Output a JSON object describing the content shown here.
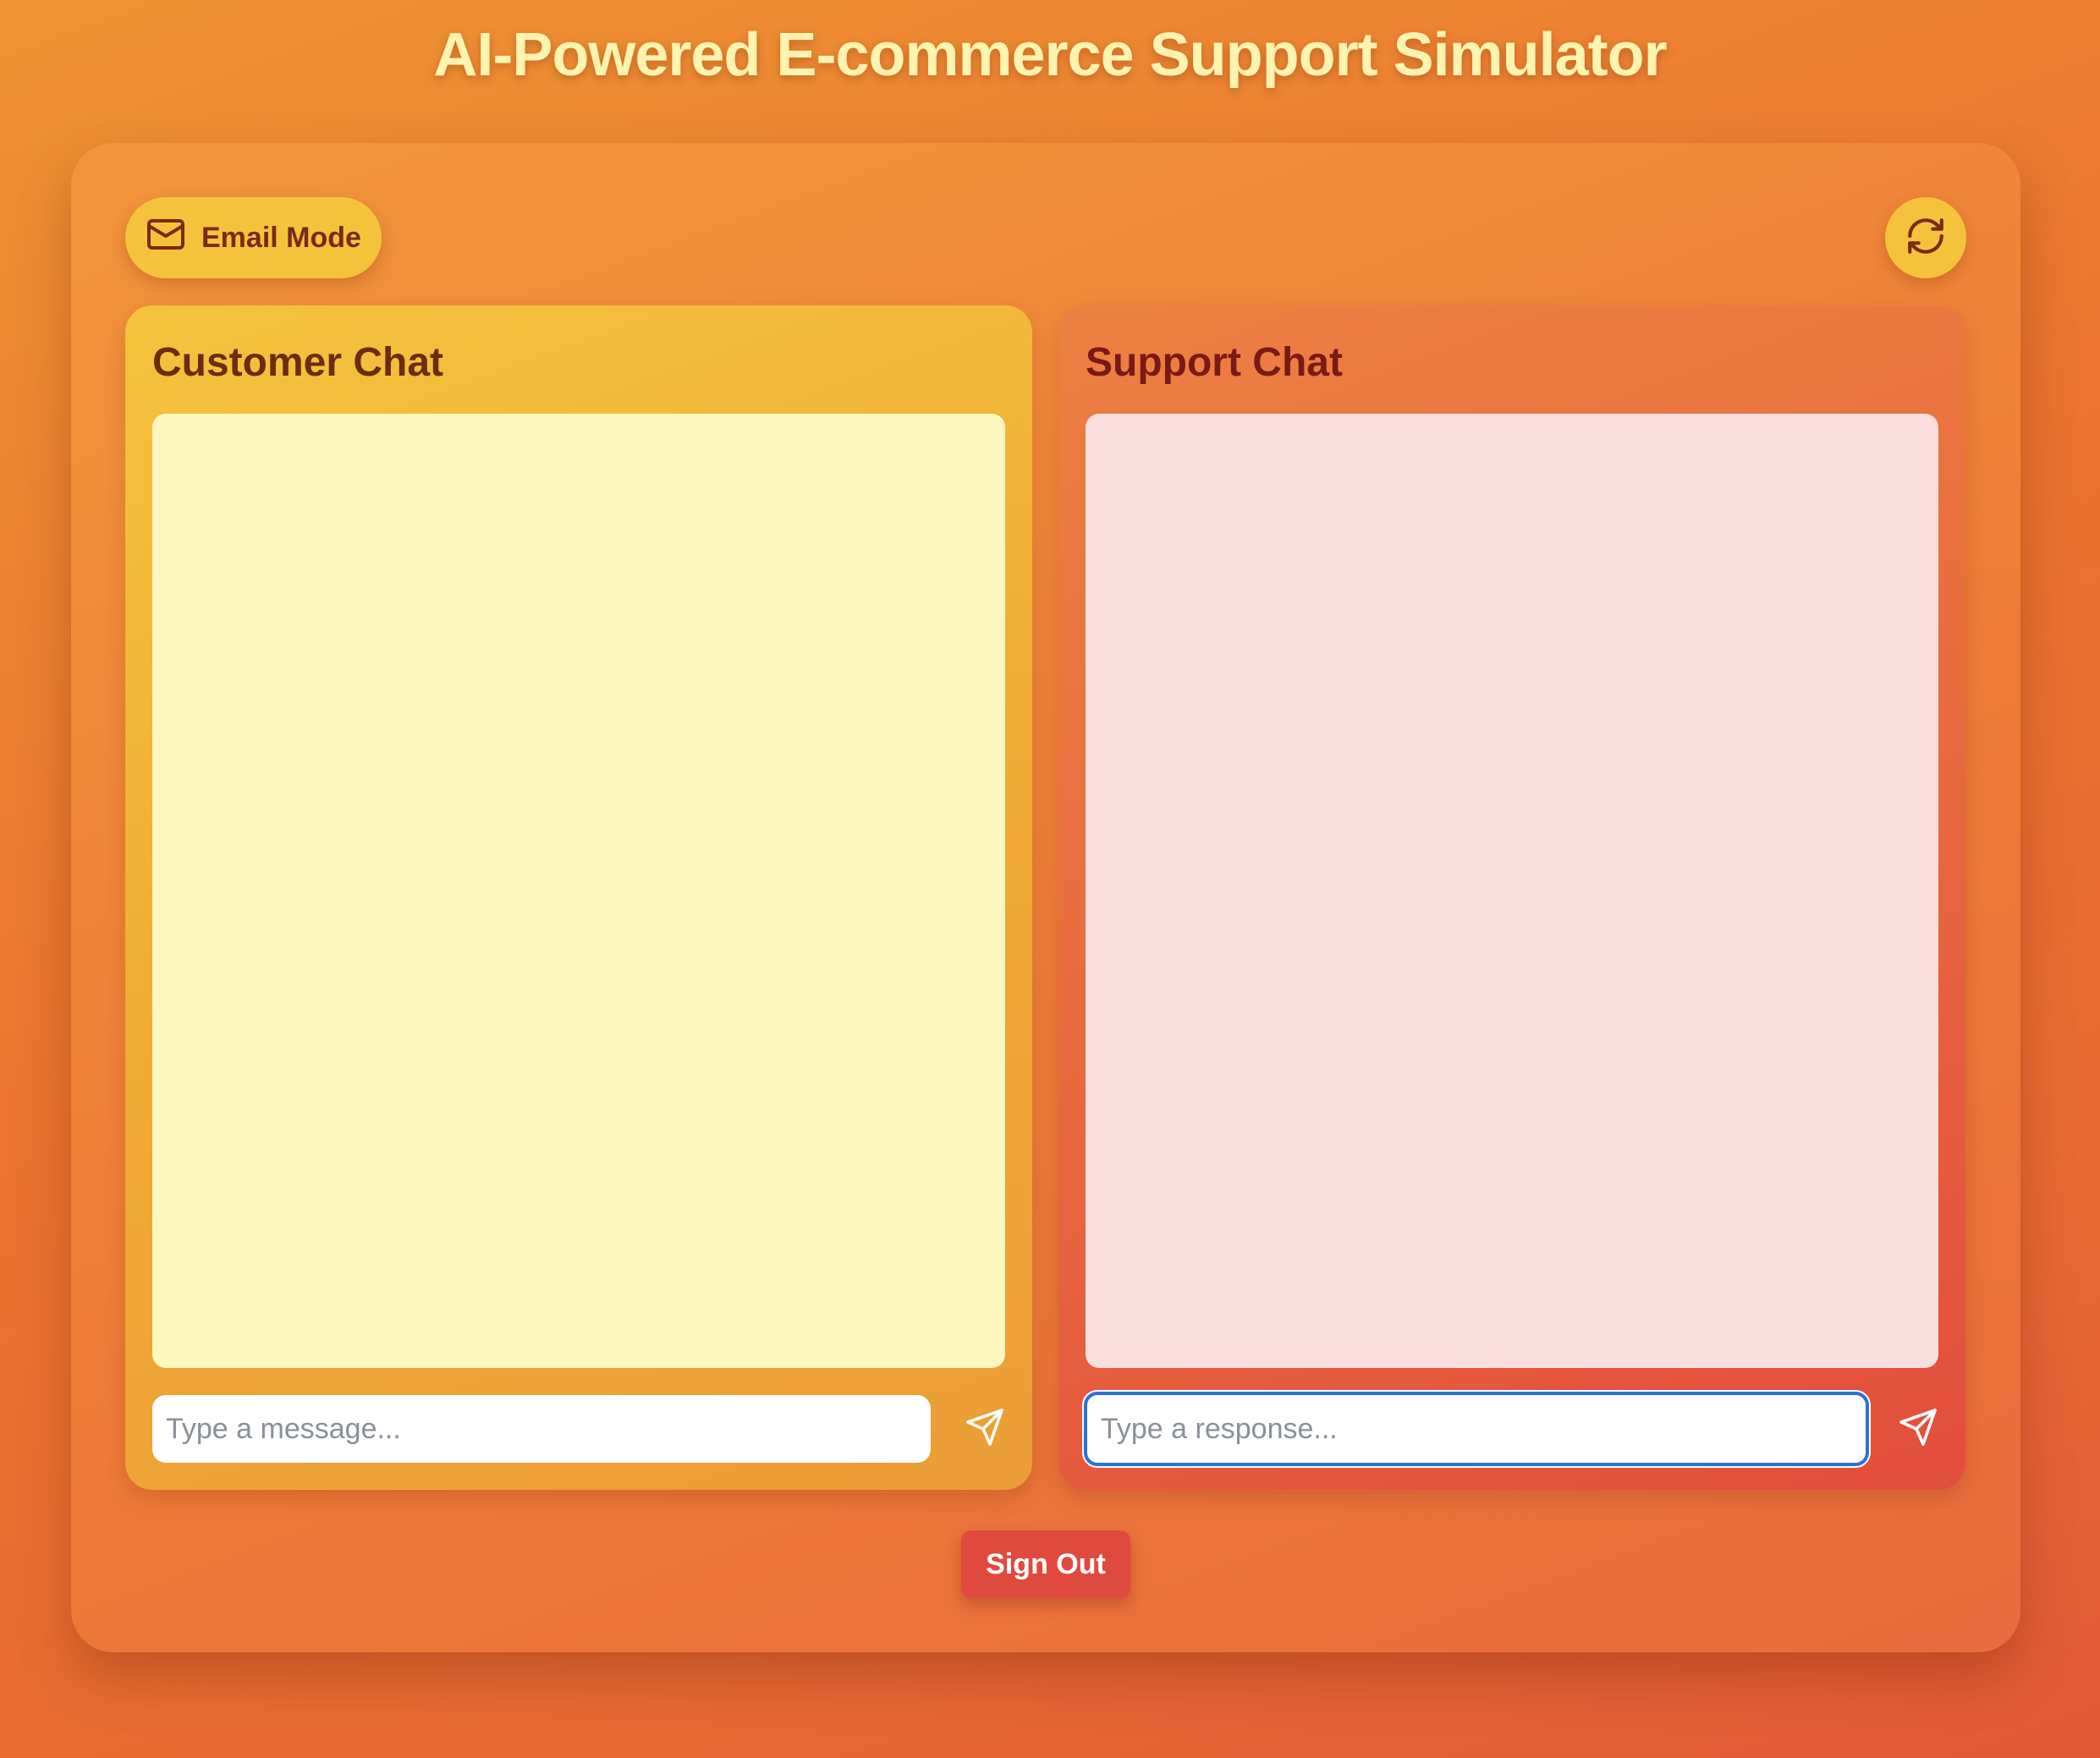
{
  "app": {
    "title": "AI-Powered E-commerce Support Simulator"
  },
  "toolbar": {
    "email_mode_label": "Email Mode",
    "email_icon": "mail-icon",
    "refresh_icon": "refresh-icon"
  },
  "customer_panel": {
    "title": "Customer Chat",
    "input_value": "",
    "input_placeholder": "Type a message...",
    "send_icon": "send-icon"
  },
  "support_panel": {
    "title": "Support Chat",
    "input_value": "",
    "input_placeholder": "Type a response...",
    "send_icon": "send-icon"
  },
  "footer": {
    "sign_out_label": "Sign Out"
  },
  "colors": {
    "background": "#eb7430",
    "title_text": "#fff3b0",
    "accent_yellow": "#f4c33b",
    "customer_panel": "#efa934",
    "customer_messages_bg": "#fef7bf",
    "support_panel": "#e96a3e",
    "support_messages_bg": "#fbdfdf",
    "sign_out": "#e04a3e",
    "focus_ring": "#2f6fd6"
  }
}
